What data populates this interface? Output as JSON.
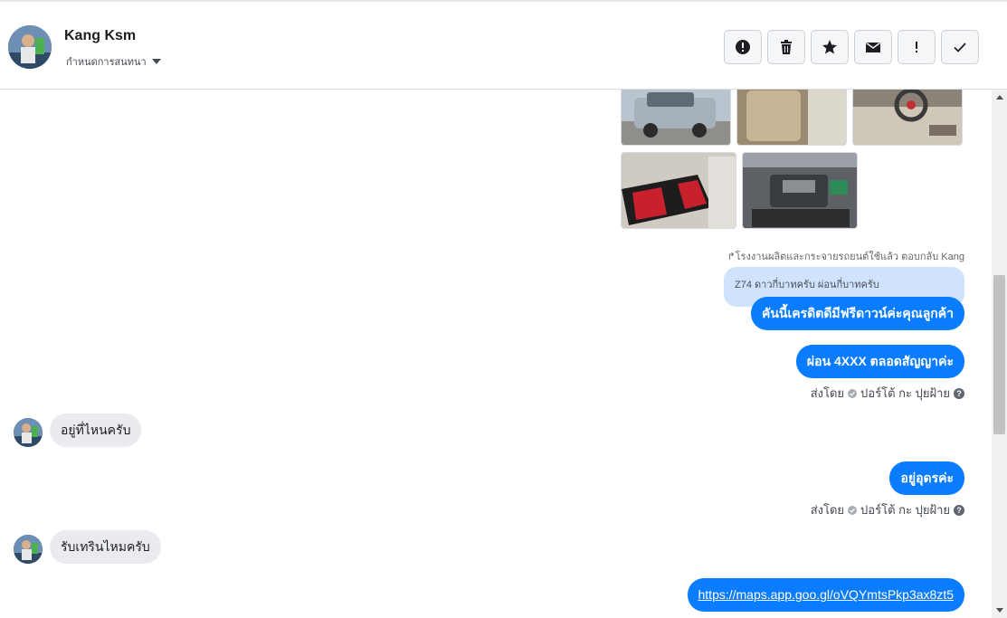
{
  "header": {
    "contact_name": "Kang Ksm",
    "conversation_settings_label": "กำหนดการสนทนา",
    "actions": [
      {
        "name": "report-button",
        "icon": "alert-circle-icon"
      },
      {
        "name": "delete-button",
        "icon": "trash-icon"
      },
      {
        "name": "star-button",
        "icon": "star-icon"
      },
      {
        "name": "mark-unread-button",
        "icon": "envelope-icon"
      },
      {
        "name": "important-button",
        "icon": "exclamation-icon"
      },
      {
        "name": "mark-done-button",
        "icon": "checkmark-icon"
      }
    ]
  },
  "thread": {
    "reply_meta": "↱โรงงานผลิตและกระจายรถยนต์ใช้แล้ว ตอบกลับ Kang",
    "quoted_text": "Z74 ดาวกี่บาทครับ ผ่อนกี่บาทครับ",
    "messages": {
      "out1": "คันนี้เครดิตดีมีฟรีดาวน์ค่ะคุณลูกค้า",
      "out2": "ผ่อน 4XXX ตลอดสัญญาค่ะ",
      "in1": "อยู่ที่ไหนครับ",
      "out3": "อยู่อุดรค่ะ",
      "in2": "รับเทรินไหมครับ",
      "out4_link": "https://maps.app.goo.gl/oVQYmtsPkp3ax8zt5"
    },
    "sent_by_label": "ส่งโดย",
    "sent_by_name": "ปอร์โต้ กะ ปุยฝ้าย",
    "help_icon_glyph": "?"
  },
  "colors": {
    "outgoing_bubble": "#0a7cff",
    "incoming_bubble": "#e9ebee",
    "quoted_bubble": "#cfe3fc"
  }
}
